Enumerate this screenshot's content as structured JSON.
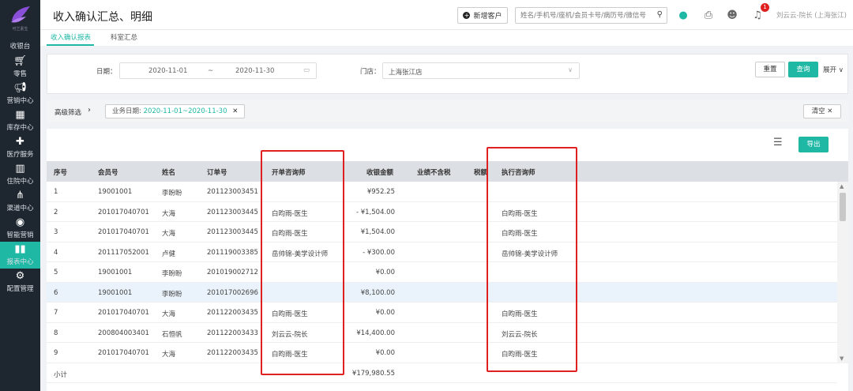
{
  "sidebar": {
    "logo_text": "可兰素生",
    "items": [
      {
        "label": "收银台",
        "icon": "cashier-icon"
      },
      {
        "label": "零售",
        "icon": "cart-icon"
      },
      {
        "label": "营销中心",
        "icon": "megaphone-icon"
      },
      {
        "label": "库存中心",
        "icon": "grid-icon"
      },
      {
        "label": "医疗服务",
        "icon": "medical-kit-icon"
      },
      {
        "label": "住院中心",
        "icon": "building-icon"
      },
      {
        "label": "渠道中心",
        "icon": "hierarchy-icon"
      },
      {
        "label": "智能营销",
        "icon": "target-icon"
      },
      {
        "label": "报表中心",
        "icon": "bar-chart-icon"
      },
      {
        "label": "配置管理",
        "icon": "gear-icon"
      }
    ],
    "active_index": 8
  },
  "header": {
    "title": "收入确认汇总、明细",
    "new_customer_label": "新增客户",
    "search_placeholder": "姓名/手机号/座机/会员卡号/病历号/微信号",
    "notification_count": "1",
    "user": "刘云云-院长 (上海张江)"
  },
  "tabs": [
    {
      "label": "收入确认报表",
      "active": true
    },
    {
      "label": "科室汇总",
      "active": false
    }
  ],
  "filter": {
    "date_label": "日期：",
    "date_start": "2020-11-01",
    "date_sep": "~",
    "date_end": "2020-11-30",
    "store_label": "门店：",
    "store_value": "上海张江店",
    "reset_label": "重置",
    "query_label": "查询",
    "expand_label": "展开"
  },
  "advanced": {
    "label": "高级筛选",
    "chip_label": "业务日期:",
    "chip_value": "2020-11-01~2020-11-30",
    "clear_label": "清空"
  },
  "table": {
    "export_label": "导出",
    "columns": [
      "序号",
      "会员号",
      "姓名",
      "订单号",
      "开单咨询师",
      "收银金额",
      "业绩不含税",
      "税额",
      "执行咨询师"
    ],
    "rows": [
      {
        "seq": "1",
        "member": "19001001",
        "name": "李盼盼",
        "order": "201123003451",
        "consultant": "",
        "amount": "¥952.25",
        "executor": ""
      },
      {
        "seq": "2",
        "member": "201017040701",
        "name": "大海",
        "order": "201123003445",
        "consultant": "白昀雨-医生",
        "amount": "- ¥1,504.00",
        "executor": "白昀雨-医生"
      },
      {
        "seq": "3",
        "member": "201017040701",
        "name": "大海",
        "order": "201123003445",
        "consultant": "白昀雨-医生",
        "amount": "¥1,504.00",
        "executor": "白昀雨-医生"
      },
      {
        "seq": "4",
        "member": "201117052001",
        "name": "卢健",
        "order": "201119003385",
        "consultant": "岳帅锦-美学设计师",
        "amount": "- ¥300.00",
        "executor": "岳帅锦-美学设计师"
      },
      {
        "seq": "5",
        "member": "19001001",
        "name": "李盼盼",
        "order": "201019002712",
        "consultant": "",
        "amount": "¥0.00",
        "executor": ""
      },
      {
        "seq": "6",
        "member": "19001001",
        "name": "李盼盼",
        "order": "201017002696",
        "consultant": "",
        "amount": "¥8,100.00",
        "executor": ""
      },
      {
        "seq": "7",
        "member": "201017040701",
        "name": "大海",
        "order": "201122003435",
        "consultant": "白昀雨-医生",
        "amount": "¥0.00",
        "executor": "白昀雨-医生"
      },
      {
        "seq": "8",
        "member": "200804003401",
        "name": "石恒帆",
        "order": "201122003433",
        "consultant": "刘云云-院长",
        "amount": "¥14,400.00",
        "executor": "刘云云-院长"
      },
      {
        "seq": "9",
        "member": "201017040701",
        "name": "大海",
        "order": "201122003435",
        "consultant": "白昀雨-医生",
        "amount": "¥0.00",
        "executor": "白昀雨-医生"
      }
    ],
    "subtotal_label": "小计",
    "subtotal_amount": "¥179,980.55"
  }
}
